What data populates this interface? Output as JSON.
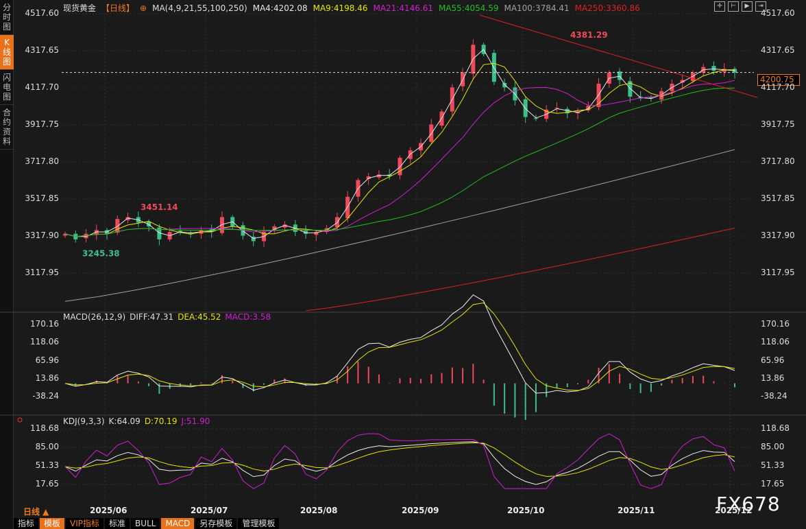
{
  "sidebar": {
    "tabs": [
      "分时图",
      "K线图",
      "闪电图",
      "合约资料"
    ],
    "active": 1
  },
  "header": {
    "symbol": "现货黄金",
    "period": "【日线】",
    "ma_label": "MA(4,9,21,55,100,250)",
    "ma": [
      {
        "t": "MA4:4202.08",
        "c": "#e6e6e6"
      },
      {
        "t": "MA9:4198.46",
        "c": "#e6e600"
      },
      {
        "t": "MA21:4146.61",
        "c": "#d020d0"
      },
      {
        "t": "MA55:4054.59",
        "c": "#20c020"
      },
      {
        "t": "MA100:3784.41",
        "c": "#a0a0a0"
      },
      {
        "t": "MA250:3360.86",
        "c": "#e02020"
      }
    ]
  },
  "current_price": "4200.75",
  "macd_header": [
    {
      "t": "MACD(26,12,9)",
      "c": "#ddd"
    },
    {
      "t": "DIFF:47.31",
      "c": "#ddd"
    },
    {
      "t": "DEA:45.52",
      "c": "#e6e600"
    },
    {
      "t": "MACD:3.58",
      "c": "#d020d0"
    }
  ],
  "kdj_header": [
    {
      "t": "KDJ(9,3,3)",
      "c": "#ddd"
    },
    {
      "t": "K:64.09",
      "c": "#ddd"
    },
    {
      "t": "D:70.19",
      "c": "#e6e600"
    },
    {
      "t": "J:51.90",
      "c": "#d020d0"
    }
  ],
  "period_label": "日线 ▲",
  "toolbar": [
    "指标",
    "模板",
    "VIP指标",
    "标准",
    "BULL",
    "MACD",
    "另存模板",
    "管理模板"
  ],
  "watermark": "FX678",
  "chart_data": [
    {
      "type": "candlestick",
      "ylim": [
        3117.95,
        4517.6
      ],
      "yticks": [
        "4517.60",
        "4317.65",
        "4117.70",
        "3917.75",
        "3717.80",
        "3517.85",
        "3317.90",
        "3117.95"
      ],
      "xticks": [
        "2025/06",
        "2025/07",
        "2025/08",
        "2025/09",
        "2025/10",
        "2025/11",
        "2025/12"
      ],
      "closes": [
        3330,
        3300,
        3330,
        3350,
        3330,
        3410,
        3420,
        3390,
        3370,
        3300,
        3340,
        3340,
        3330,
        3350,
        3340,
        3420,
        3370,
        3320,
        3290,
        3340,
        3370,
        3380,
        3340,
        3330,
        3340,
        3360,
        3420,
        3530,
        3620,
        3640,
        3650,
        3640,
        3740,
        3780,
        3820,
        3920,
        3990,
        4120,
        4200,
        4350,
        4300,
        4150,
        4120,
        4050,
        3960,
        3950,
        4000,
        4010,
        3980,
        3990,
        4020,
        4140,
        4200,
        4160,
        4070,
        4060,
        4060,
        4100,
        4140,
        4160,
        4200,
        4230,
        4210,
        4220,
        4200
      ],
      "annotations": [
        {
          "t": "4381.29",
          "v": 4381.29
        },
        {
          "t": "3451.14",
          "v": 3451.14
        },
        {
          "t": "3245.38",
          "v": 3245.38
        }
      ],
      "ma100": [
        [
          0,
          2965
        ],
        [
          64,
          3784.41
        ]
      ],
      "ma250": [
        [
          23,
          2915
        ],
        [
          64,
          3360.86
        ]
      ],
      "trendline": [
        [
          4517.6,
          0
        ],
        [
          4100,
          64
        ]
      ]
    },
    {
      "type": "macd",
      "ylim": [
        -38.24,
        170.16
      ],
      "yticks": [
        "170.16",
        "118.06",
        "65.96",
        "13.86",
        "-38.24"
      ]
    },
    {
      "type": "kdj",
      "ylim": [
        17.65,
        118.68
      ],
      "yticks": [
        "118.68",
        "85.00",
        "51.33",
        "17.65"
      ]
    }
  ]
}
